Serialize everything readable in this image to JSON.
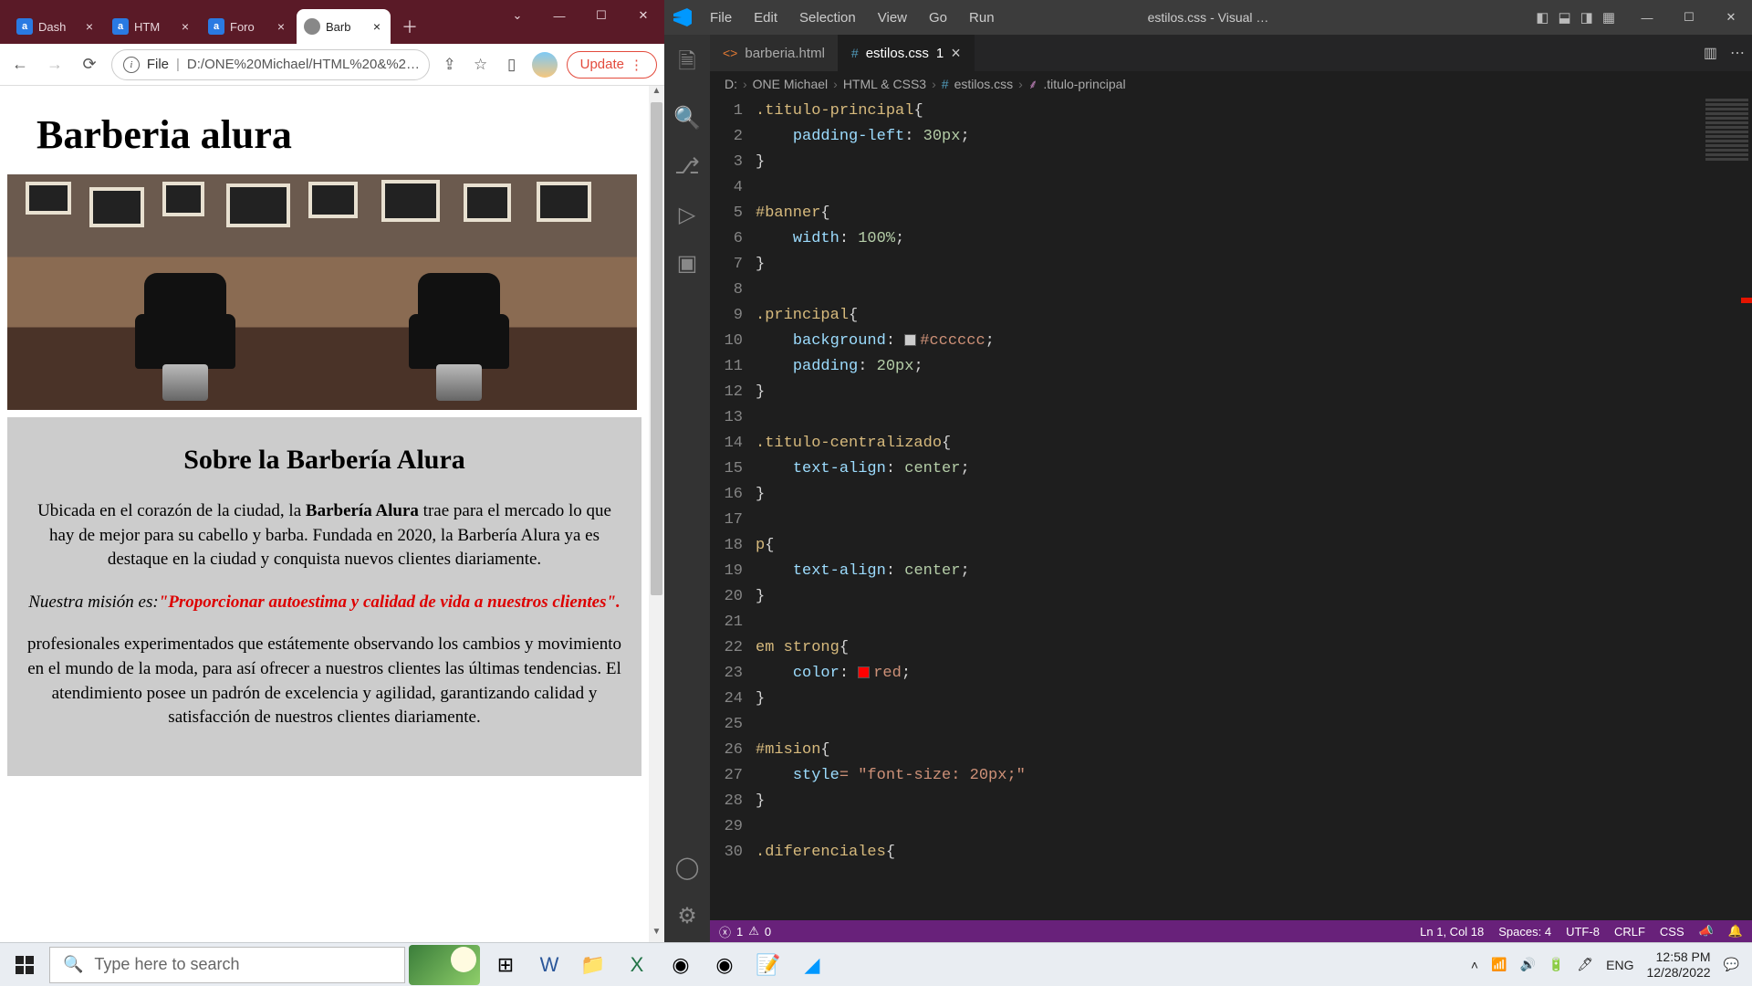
{
  "browser": {
    "tabs": [
      {
        "title": "Dash",
        "favicon": "a"
      },
      {
        "title": "HTM",
        "favicon": "a"
      },
      {
        "title": "Foro",
        "favicon": "a"
      },
      {
        "title": "Barb",
        "favicon": "globe",
        "active": true
      }
    ],
    "nav": {
      "back": "←",
      "forward": "→",
      "reload": "⟳"
    },
    "omnibox": {
      "info": "i",
      "file_label": "File",
      "path": "D:/ONE%20Michael/HTML%20&%2…"
    },
    "share_icon": "⇪",
    "star_icon": "☆",
    "reader_icon": "▯",
    "update_label": "Update"
  },
  "page": {
    "h1": "Barberia alura",
    "h2": "Sobre la Barbería Alura",
    "p1_a": "Ubicada en el corazón de la ciudad, la ",
    "p1_b": "Barbería Alura",
    "p1_c": " trae para el mercado lo que hay de mejor para su cabello y barba. Fundada en 2020, la Barbería Alura ya es destaque en la ciudad y conquista nuevos clientes diariamente.",
    "p2_em": "Nuestra misión es:",
    "p2_quote": "\"Proporcionar autoestima y calidad de vida a nuestros clientes\".",
    "p3": "profesionales experimentados que estátemente observando los cambios y movimiento en el mundo de la moda, para así ofrecer a nuestros clientes las últimas tendencias. El atendimiento posee un padrón de excelencia y agilidad, garantizando calidad y satisfacción de nuestros clientes diariamente."
  },
  "vscode": {
    "menu": [
      "File",
      "Edit",
      "Selection",
      "View",
      "Go",
      "Run"
    ],
    "title_center": "estilos.css - Visual …",
    "tabs": [
      {
        "label": "barberia.html",
        "kind": "html"
      },
      {
        "label": "estilos.css",
        "kind": "css",
        "dirty": "1",
        "active": true
      }
    ],
    "breadcrumbs": [
      "D:",
      "ONE Michael",
      "HTML & CSS3",
      "estilos.css",
      ".titulo-principal"
    ],
    "code": {
      "1": {
        "sel": ".titulo-principal",
        "open": "{"
      },
      "2": {
        "prop": "padding-left",
        "val": "30px"
      },
      "3": {
        "close": "}"
      },
      "4": {},
      "5": {
        "sel": "#banner",
        "open": "{"
      },
      "6": {
        "prop": "width",
        "val": "100%"
      },
      "7": {
        "close": "}"
      },
      "8": {},
      "9": {
        "sel": ".principal",
        "open": "{"
      },
      "10": {
        "prop": "background",
        "color": "#cccccc"
      },
      "11": {
        "prop": "padding",
        "val": "20px"
      },
      "12": {
        "close": "}"
      },
      "13": {},
      "14": {
        "sel": ".titulo-centralizado",
        "open": "{"
      },
      "15": {
        "prop": "text-align",
        "val": "center"
      },
      "16": {
        "close": "}"
      },
      "17": {},
      "18": {
        "sel": "p",
        "open": "{"
      },
      "19": {
        "prop": "text-align",
        "val": "center"
      },
      "20": {
        "close": "}"
      },
      "21": {},
      "22": {
        "sel": "em strong",
        "open": "{"
      },
      "23": {
        "prop": "color",
        "color": "red",
        "swatch": "#ff0000"
      },
      "24": {
        "close": "}"
      },
      "25": {},
      "26": {
        "sel": "#mision",
        "open": "{"
      },
      "27": {
        "prop": "style",
        "raw": "= \"font-size: 20px;\""
      },
      "28": {
        "close": "}"
      },
      "29": {},
      "30": {
        "sel": ".diferenciales",
        "open": "{"
      }
    },
    "status": {
      "errors": "1",
      "warnings": "0",
      "cursor": "Ln 1, Col 18",
      "spaces": "Spaces: 4",
      "encoding": "UTF-8",
      "eol": "CRLF",
      "lang": "CSS"
    }
  },
  "taskbar": {
    "search_placeholder": "Type here to search",
    "lang": "ENG",
    "time": "12:58 PM",
    "date": "12/28/2022"
  }
}
